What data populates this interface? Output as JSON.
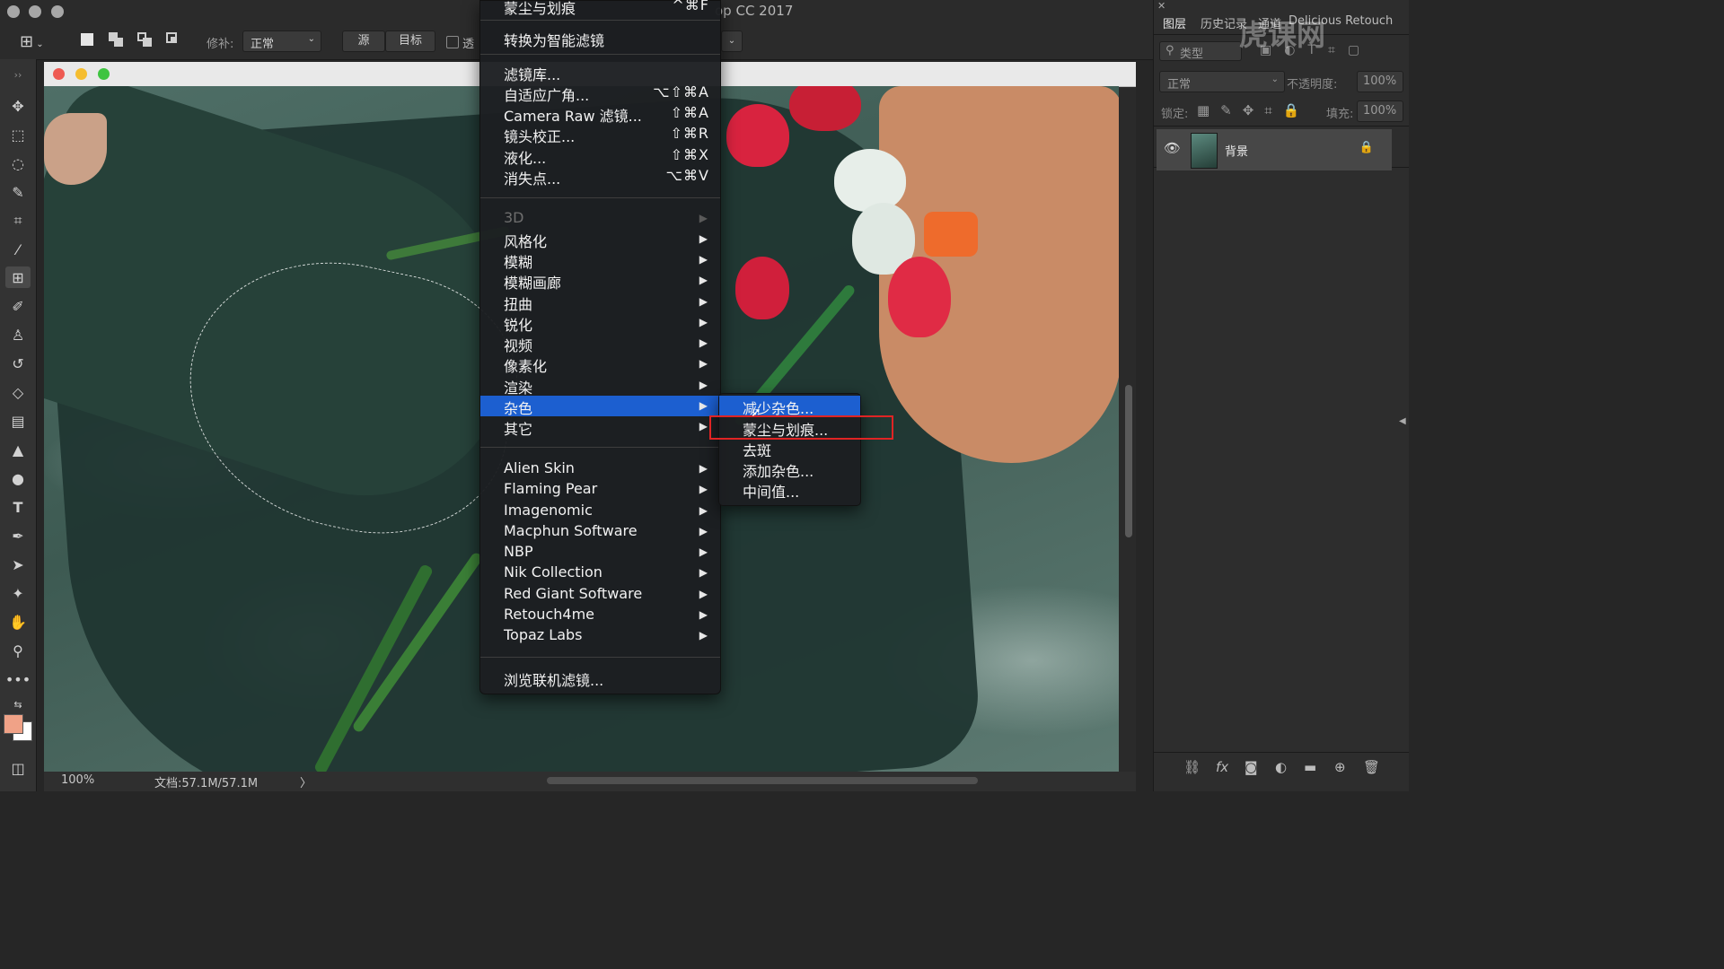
{
  "app": {
    "title": "op CC 2017",
    "watermark": "虎课网"
  },
  "options_bar": {
    "repair_label": "修补:",
    "mode_value": "正常",
    "source_button": "源",
    "target_button": "目标",
    "transparent_label": "透"
  },
  "document": {
    "zoom": "100%",
    "doc_info": "文档:57.1M/57.1M",
    "status_arrow": "〉"
  },
  "filter_menu": {
    "top_partial": {
      "label": "蒙尘与划痕",
      "shortcut": "^⌘F"
    },
    "convert_smart": "转换为智能滤镜",
    "group1": [
      {
        "label": "滤镜库...",
        "shortcut": ""
      },
      {
        "label": "自适应广角...",
        "shortcut": "⌥⇧⌘A"
      },
      {
        "label": "Camera Raw 滤镜...",
        "shortcut": "⇧⌘A"
      },
      {
        "label": "镜头校正...",
        "shortcut": "⇧⌘R"
      },
      {
        "label": "液化...",
        "shortcut": "⇧⌘X"
      },
      {
        "label": "消失点...",
        "shortcut": "⌥⌘V"
      }
    ],
    "group2": [
      {
        "label": "3D",
        "arrow": "▶"
      },
      {
        "label": "风格化",
        "arrow": "▶"
      },
      {
        "label": "模糊",
        "arrow": "▶"
      },
      {
        "label": "模糊画廊",
        "arrow": "▶"
      },
      {
        "label": "扭曲",
        "arrow": "▶"
      },
      {
        "label": "锐化",
        "arrow": "▶"
      },
      {
        "label": "视频",
        "arrow": "▶"
      },
      {
        "label": "像素化",
        "arrow": "▶"
      },
      {
        "label": "渲染",
        "arrow": "▶"
      },
      {
        "label": "杂色",
        "arrow": "▶"
      },
      {
        "label": "其它",
        "arrow": "▶"
      }
    ],
    "group3": [
      {
        "label": "Alien Skin",
        "arrow": "▶"
      },
      {
        "label": "Flaming Pear",
        "arrow": "▶"
      },
      {
        "label": "Imagenomic",
        "arrow": "▶"
      },
      {
        "label": "Macphun Software",
        "arrow": "▶"
      },
      {
        "label": "NBP",
        "arrow": "▶"
      },
      {
        "label": "Nik Collection",
        "arrow": "▶"
      },
      {
        "label": "Red Giant Software",
        "arrow": "▶"
      },
      {
        "label": "Retouch4me",
        "arrow": "▶"
      },
      {
        "label": "Topaz Labs",
        "arrow": "▶"
      }
    ],
    "browse_online": "浏览联机滤镜..."
  },
  "noise_submenu": {
    "items": [
      "减少杂色...",
      "蒙尘与划痕...",
      "去斑",
      "添加杂色...",
      "中间值..."
    ]
  },
  "layers_panel": {
    "tabs": [
      "图层",
      "历史记录",
      "通道",
      "Delicious Retouch"
    ],
    "filter_kind": "类型",
    "blend_mode": "正常",
    "opacity_label": "不透明度:",
    "opacity_value": "100%",
    "lock_label": "锁定:",
    "fill_label": "填充:",
    "fill_value": "100%",
    "layer_name": "背景"
  },
  "colors": {
    "highlight": "#1c5fd0",
    "red_box": "#e02424",
    "foreground": "#f0a287",
    "background": "#ffffff"
  }
}
